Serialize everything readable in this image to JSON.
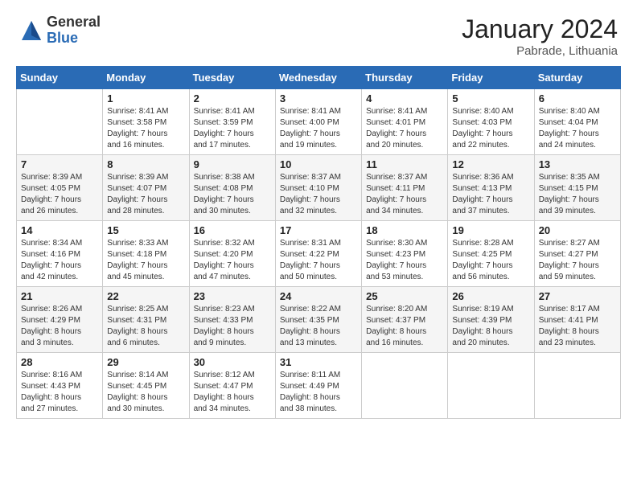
{
  "logo": {
    "general": "General",
    "blue": "Blue"
  },
  "title": "January 2024",
  "subtitle": "Pabrade, Lithuania",
  "days": [
    "Sunday",
    "Monday",
    "Tuesday",
    "Wednesday",
    "Thursday",
    "Friday",
    "Saturday"
  ],
  "weeks": [
    [
      {
        "day": "",
        "content": ""
      },
      {
        "day": "1",
        "content": "Sunrise: 8:41 AM\nSunset: 3:58 PM\nDaylight: 7 hours\nand 16 minutes."
      },
      {
        "day": "2",
        "content": "Sunrise: 8:41 AM\nSunset: 3:59 PM\nDaylight: 7 hours\nand 17 minutes."
      },
      {
        "day": "3",
        "content": "Sunrise: 8:41 AM\nSunset: 4:00 PM\nDaylight: 7 hours\nand 19 minutes."
      },
      {
        "day": "4",
        "content": "Sunrise: 8:41 AM\nSunset: 4:01 PM\nDaylight: 7 hours\nand 20 minutes."
      },
      {
        "day": "5",
        "content": "Sunrise: 8:40 AM\nSunset: 4:03 PM\nDaylight: 7 hours\nand 22 minutes."
      },
      {
        "day": "6",
        "content": "Sunrise: 8:40 AM\nSunset: 4:04 PM\nDaylight: 7 hours\nand 24 minutes."
      }
    ],
    [
      {
        "day": "7",
        "content": "Sunrise: 8:39 AM\nSunset: 4:05 PM\nDaylight: 7 hours\nand 26 minutes."
      },
      {
        "day": "8",
        "content": "Sunrise: 8:39 AM\nSunset: 4:07 PM\nDaylight: 7 hours\nand 28 minutes."
      },
      {
        "day": "9",
        "content": "Sunrise: 8:38 AM\nSunset: 4:08 PM\nDaylight: 7 hours\nand 30 minutes."
      },
      {
        "day": "10",
        "content": "Sunrise: 8:37 AM\nSunset: 4:10 PM\nDaylight: 7 hours\nand 32 minutes."
      },
      {
        "day": "11",
        "content": "Sunrise: 8:37 AM\nSunset: 4:11 PM\nDaylight: 7 hours\nand 34 minutes."
      },
      {
        "day": "12",
        "content": "Sunrise: 8:36 AM\nSunset: 4:13 PM\nDaylight: 7 hours\nand 37 minutes."
      },
      {
        "day": "13",
        "content": "Sunrise: 8:35 AM\nSunset: 4:15 PM\nDaylight: 7 hours\nand 39 minutes."
      }
    ],
    [
      {
        "day": "14",
        "content": "Sunrise: 8:34 AM\nSunset: 4:16 PM\nDaylight: 7 hours\nand 42 minutes."
      },
      {
        "day": "15",
        "content": "Sunrise: 8:33 AM\nSunset: 4:18 PM\nDaylight: 7 hours\nand 45 minutes."
      },
      {
        "day": "16",
        "content": "Sunrise: 8:32 AM\nSunset: 4:20 PM\nDaylight: 7 hours\nand 47 minutes."
      },
      {
        "day": "17",
        "content": "Sunrise: 8:31 AM\nSunset: 4:22 PM\nDaylight: 7 hours\nand 50 minutes."
      },
      {
        "day": "18",
        "content": "Sunrise: 8:30 AM\nSunset: 4:23 PM\nDaylight: 7 hours\nand 53 minutes."
      },
      {
        "day": "19",
        "content": "Sunrise: 8:28 AM\nSunset: 4:25 PM\nDaylight: 7 hours\nand 56 minutes."
      },
      {
        "day": "20",
        "content": "Sunrise: 8:27 AM\nSunset: 4:27 PM\nDaylight: 7 hours\nand 59 minutes."
      }
    ],
    [
      {
        "day": "21",
        "content": "Sunrise: 8:26 AM\nSunset: 4:29 PM\nDaylight: 8 hours\nand 3 minutes."
      },
      {
        "day": "22",
        "content": "Sunrise: 8:25 AM\nSunset: 4:31 PM\nDaylight: 8 hours\nand 6 minutes."
      },
      {
        "day": "23",
        "content": "Sunrise: 8:23 AM\nSunset: 4:33 PM\nDaylight: 8 hours\nand 9 minutes."
      },
      {
        "day": "24",
        "content": "Sunrise: 8:22 AM\nSunset: 4:35 PM\nDaylight: 8 hours\nand 13 minutes."
      },
      {
        "day": "25",
        "content": "Sunrise: 8:20 AM\nSunset: 4:37 PM\nDaylight: 8 hours\nand 16 minutes."
      },
      {
        "day": "26",
        "content": "Sunrise: 8:19 AM\nSunset: 4:39 PM\nDaylight: 8 hours\nand 20 minutes."
      },
      {
        "day": "27",
        "content": "Sunrise: 8:17 AM\nSunset: 4:41 PM\nDaylight: 8 hours\nand 23 minutes."
      }
    ],
    [
      {
        "day": "28",
        "content": "Sunrise: 8:16 AM\nSunset: 4:43 PM\nDaylight: 8 hours\nand 27 minutes."
      },
      {
        "day": "29",
        "content": "Sunrise: 8:14 AM\nSunset: 4:45 PM\nDaylight: 8 hours\nand 30 minutes."
      },
      {
        "day": "30",
        "content": "Sunrise: 8:12 AM\nSunset: 4:47 PM\nDaylight: 8 hours\nand 34 minutes."
      },
      {
        "day": "31",
        "content": "Sunrise: 8:11 AM\nSunset: 4:49 PM\nDaylight: 8 hours\nand 38 minutes."
      },
      {
        "day": "",
        "content": ""
      },
      {
        "day": "",
        "content": ""
      },
      {
        "day": "",
        "content": ""
      }
    ]
  ]
}
